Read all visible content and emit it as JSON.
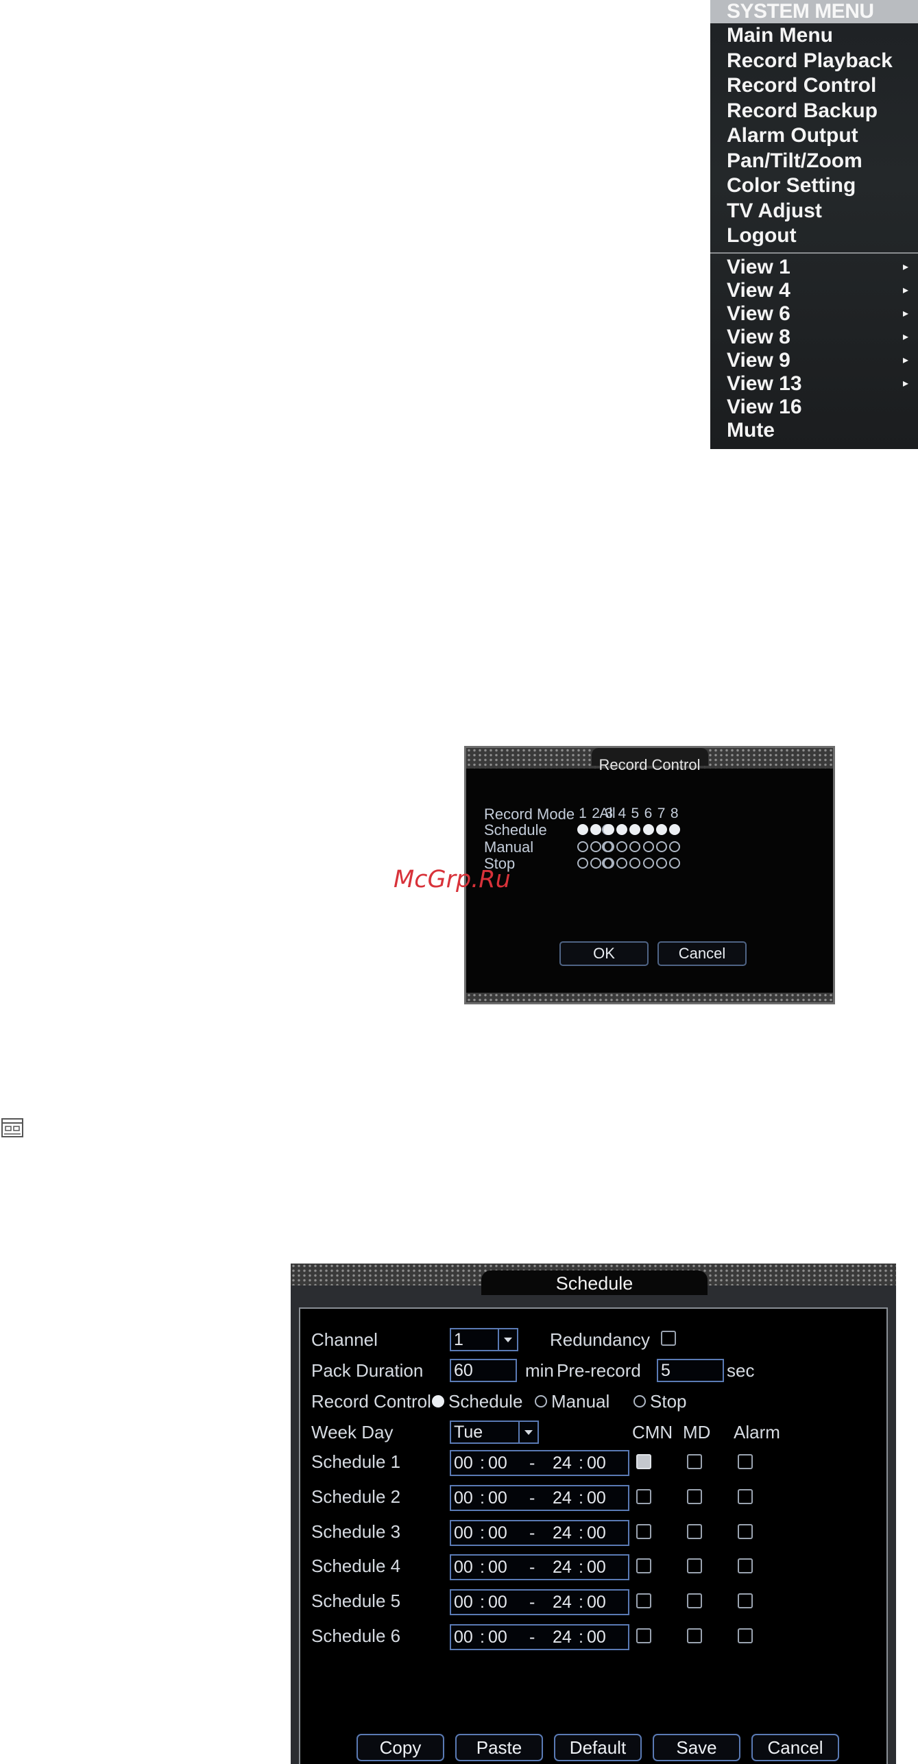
{
  "system_menu": {
    "title": "SYSTEM MENU",
    "items": [
      "Main Menu",
      "Record Playback",
      "Record Control",
      "Record Backup",
      "Alarm Output",
      "Pan/Tilt/Zoom",
      "Color Setting",
      "TV Adjust",
      "Logout"
    ],
    "views": [
      {
        "label": "View 1",
        "submenu": true
      },
      {
        "label": "View 4",
        "submenu": true
      },
      {
        "label": "View 6",
        "submenu": true
      },
      {
        "label": "View 8",
        "submenu": true
      },
      {
        "label": "View 9",
        "submenu": true
      },
      {
        "label": "View 13",
        "submenu": true
      },
      {
        "label": "View 16",
        "submenu": false
      },
      {
        "label": "Mute",
        "submenu": false
      }
    ],
    "arrow_glyph": "▸"
  },
  "record_control": {
    "title": "Record Control",
    "header_label": "Record Mode",
    "all_label": "All",
    "channels": [
      "1",
      "2",
      "3",
      "4",
      "5",
      "6",
      "7",
      "8"
    ],
    "rows": [
      {
        "label": "Schedule",
        "all": false,
        "channels": [
          true,
          true,
          true,
          true,
          true,
          true,
          true,
          true
        ]
      },
      {
        "label": "Manual",
        "all": false,
        "channels": [
          false,
          false,
          false,
          false,
          false,
          false,
          false,
          false
        ]
      },
      {
        "label": "Stop",
        "all": false,
        "channels": [
          false,
          false,
          false,
          false,
          false,
          false,
          false,
          false
        ]
      }
    ],
    "ok_label": "OK",
    "cancel_label": "Cancel"
  },
  "watermark": "McGrp.Ru",
  "icon_name": "schedule-icon",
  "schedule": {
    "title": "Schedule",
    "channel_label": "Channel",
    "channel_value": "1",
    "redundancy_label": "Redundancy",
    "redundancy_checked": false,
    "pack_duration_label": "Pack Duration",
    "pack_duration_value": "60",
    "pack_duration_unit": "min",
    "prerecord_label": "Pre-record",
    "prerecord_value": "5",
    "prerecord_unit": "sec",
    "record_control_label": "Record Control",
    "modes": [
      {
        "label": "Schedule",
        "selected": true
      },
      {
        "label": "Manual",
        "selected": false
      },
      {
        "label": "Stop",
        "selected": false
      }
    ],
    "weekday_label": "Week Day",
    "weekday_value": "Tue",
    "col_cmn": "CMN",
    "col_md": "MD",
    "col_alarm": "Alarm",
    "periods": [
      {
        "label": "Schedule 1",
        "start_h": "00",
        "start_m": "00",
        "end_h": "24",
        "end_m": "00",
        "cmn": true,
        "md": false,
        "alarm": false
      },
      {
        "label": "Schedule 2",
        "start_h": "00",
        "start_m": "00",
        "end_h": "24",
        "end_m": "00",
        "cmn": false,
        "md": false,
        "alarm": false
      },
      {
        "label": "Schedule 3",
        "start_h": "00",
        "start_m": "00",
        "end_h": "24",
        "end_m": "00",
        "cmn": false,
        "md": false,
        "alarm": false
      },
      {
        "label": "Schedule 4",
        "start_h": "00",
        "start_m": "00",
        "end_h": "24",
        "end_m": "00",
        "cmn": false,
        "md": false,
        "alarm": false
      },
      {
        "label": "Schedule 5",
        "start_h": "00",
        "start_m": "00",
        "end_h": "24",
        "end_m": "00",
        "cmn": false,
        "md": false,
        "alarm": false
      },
      {
        "label": "Schedule 6",
        "start_h": "00",
        "start_m": "00",
        "end_h": "24",
        "end_m": "00",
        "cmn": false,
        "md": false,
        "alarm": false
      }
    ],
    "time_sep": ":",
    "range_sep": "-",
    "buttons": [
      "Copy",
      "Paste",
      "Default",
      "Save",
      "Cancel"
    ]
  }
}
